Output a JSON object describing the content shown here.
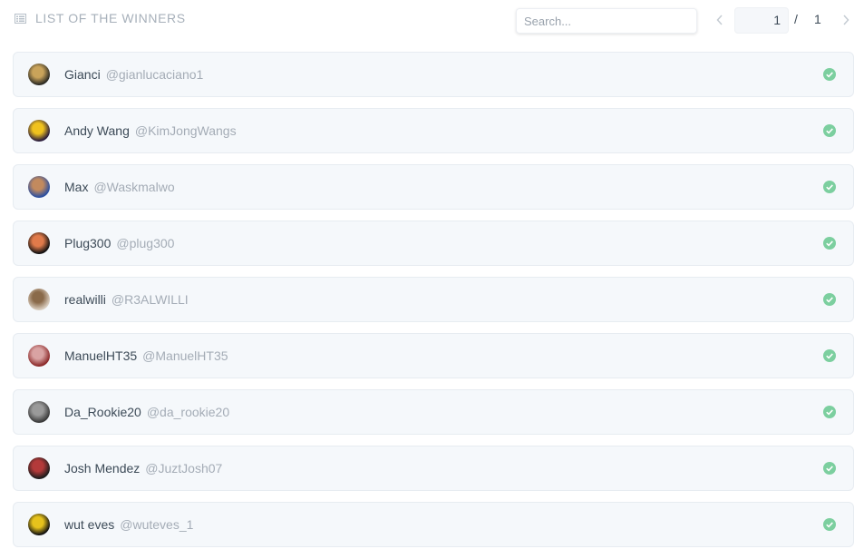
{
  "header": {
    "title": "LIST OF THE WINNERS",
    "title_icon": "list-icon"
  },
  "search": {
    "placeholder": "Search...",
    "value": ""
  },
  "pagination": {
    "current_page": "1",
    "separator": "/",
    "total_pages": "1",
    "prev_icon": "chevron-left-icon",
    "next_icon": "chevron-right-icon"
  },
  "colors": {
    "check_green": "#7ccf9f",
    "row_bg": "#f5f8fb",
    "muted_text": "#a4acb6"
  },
  "winners": [
    {
      "name": "Gianci",
      "handle": "@gianlucaciano1",
      "avatar_colors": [
        "#2b2a24",
        "#c9a35a"
      ]
    },
    {
      "name": "Andy Wang",
      "handle": "@KimJongWangs",
      "avatar_colors": [
        "#2a1c3c",
        "#f0c21e"
      ]
    },
    {
      "name": "Max",
      "handle": "@Waskmalwo",
      "avatar_colors": [
        "#2b4fa0",
        "#c28a5e"
      ]
    },
    {
      "name": "Plug300",
      "handle": "@plug300",
      "avatar_colors": [
        "#111111",
        "#e07a4a"
      ]
    },
    {
      "name": "realwilli",
      "handle": "@R3ALWILLI",
      "avatar_colors": [
        "#d9cdbf",
        "#8a6a4a"
      ]
    },
    {
      "name": "ManuelHT35",
      "handle": "@ManuelHT35",
      "avatar_colors": [
        "#8c2a2a",
        "#d9a3a3"
      ]
    },
    {
      "name": "Da_Rookie20",
      "handle": "@da_rookie20",
      "avatar_colors": [
        "#3a3a3a",
        "#9a9a9a"
      ]
    },
    {
      "name": "Josh Mendez",
      "handle": "@JuztJosh07",
      "avatar_colors": [
        "#1d1d1d",
        "#b33a3a"
      ]
    },
    {
      "name": "wut eves",
      "handle": "@wuteves_1",
      "avatar_colors": [
        "#111111",
        "#e6c21c"
      ]
    }
  ]
}
